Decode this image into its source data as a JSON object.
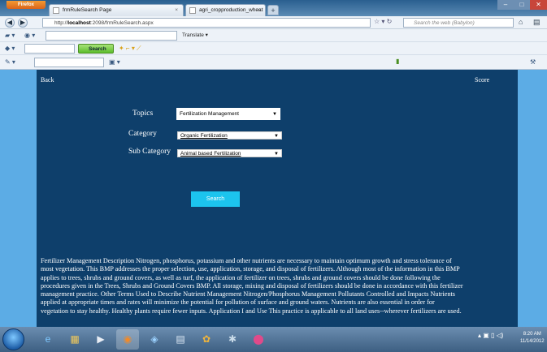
{
  "browser": {
    "app_button": "Firefox",
    "tabs": [
      {
        "label": "frmRuleSearch Page"
      },
      {
        "label": "agri_cropproduction_wheat Page"
      }
    ],
    "url_prefix": "http://",
    "url_host": "localhost",
    "url_rest": ":2098/frmRuleSearch.aspx",
    "search_placeholder": "Search the web (Babylon)",
    "translate_label": "Translate",
    "toolbar_search_label": "Search"
  },
  "page": {
    "back_link": "Back",
    "score_link": "Score",
    "form": {
      "topics_label": "Topics",
      "topics_value": "Fertilization Management",
      "category_label": "Category",
      "category_value": "Organic Fertilization",
      "subcategory_label": "Sub Category",
      "subcategory_value": "Animal based Fertilization",
      "search_button": "Search"
    },
    "description": "Fertilizer Management Description Nitrogen, phosphorus, potassium and other nutrients are necessary to maintain optimum growth and stress tolerance of most vegetation. This BMP addresses the proper selection, use, application, storage, and disposal of fertilizers. Although most of the information in this BMP applies to trees, shrubs and ground covers, as well as turf, the application of fertilizer on trees, shrubs and ground covers should be done following the procedures given in the Trees, Shrubs and Ground Covers BMP. All storage, mixing and disposal of fertilizers should be done in accordance with this fertilizer management practice. Other Terms Used to Describe Nutrient Management Nitrogen/Phosphorus Management Pollutants Controlled and Impacts Nutrients applied at appropriate times and rates will minimize the potential for pollution of surface and ground waters. Nutrients are also essential in order for vegetation to stay healthy. Healthy plants require fewer inputs. Application I and Use This practice is applicable to all land uses--wherever fertilizers are used."
  },
  "taskbar": {
    "clock_time": "8:20 AM",
    "clock_date": "11/14/2012"
  },
  "colors": {
    "page_bg": "#5cace5",
    "panel_bg": "#0e3f6b",
    "search_button": "#1cc4ee"
  }
}
